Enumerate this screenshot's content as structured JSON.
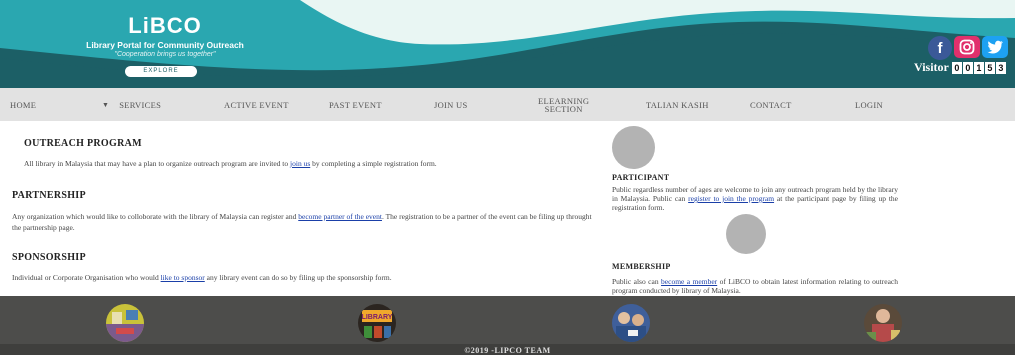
{
  "header": {
    "logo": "LiBCO",
    "tagline": "Library Portal for Community Outreach",
    "motto": "\"Cooperation brings us together\"",
    "explore_label": "EXPLORE",
    "social": [
      {
        "icon": "facebook-icon",
        "glyph": "f",
        "color": "#3b5998"
      },
      {
        "icon": "instagram-icon",
        "glyph": "◎",
        "color": "#e1306c"
      },
      {
        "icon": "twitter-icon",
        "glyph": "🐦",
        "color": "#1da1f2"
      }
    ],
    "visitor_label": "Visitor",
    "visitor_digits": [
      "0",
      "0",
      "1",
      "5",
      "3"
    ]
  },
  "nav": {
    "home": "HOME",
    "services": "SERVICES",
    "active_event": "ACTIVE EVENT",
    "past_event": "PAST EVENT",
    "join_us": "JOIN US",
    "elearning_line1": "ELEARNING",
    "elearning_line2": "SECTION",
    "talian_kasih": "TALIAN KASIH",
    "contact": "CONTACT",
    "login": "LOGIN"
  },
  "outreach": {
    "title": "OUTREACH PROGRAM",
    "text_before": "All library in Malaysia that may have a plan to organize outreach program are invited to ",
    "link": "join us",
    "text_after": " by completing a simple registration form."
  },
  "partnership": {
    "title": "PARTNERSHIP",
    "text_before": "Any organization which would like to colloborate with the library of Malaysia can register and ",
    "link": "become partner of the event",
    "text_after": ". The registration to be a partner of the event can be filing up throught the partnership page."
  },
  "sponsorship": {
    "title": "SPONSORSHIP",
    "text_before": "Individual or Corporate Organisation who would ",
    "link": "like to sponsor",
    "text_after": " any library event can do so by filing up the sponsorship form."
  },
  "participant": {
    "title": "PARTICIPANT",
    "text_before": "Public regardless number of ages are welcome to join any outreach program held by the library in Malaysia. Public can ",
    "link": "register to join the program",
    "text_after": " at the participant page by filing up the registration form."
  },
  "membership": {
    "title": "MEMBERSHIP",
    "text_before": "Public also can ",
    "link": "become a member",
    "text_after": " of LiBCO to obtain latest information relating to outreach program conducted by library of Malaysia."
  },
  "footer": {
    "thumb2_label": "LIBRARY",
    "copyright": "©2019 -LIPCO TEAM"
  },
  "colors": {
    "header_dark": "#1c5f66",
    "header_teal": "#2aa7b0",
    "nav_bg": "#e2e2e2",
    "link": "#1a3fa8",
    "footer_bg": "#4d4d4b"
  }
}
